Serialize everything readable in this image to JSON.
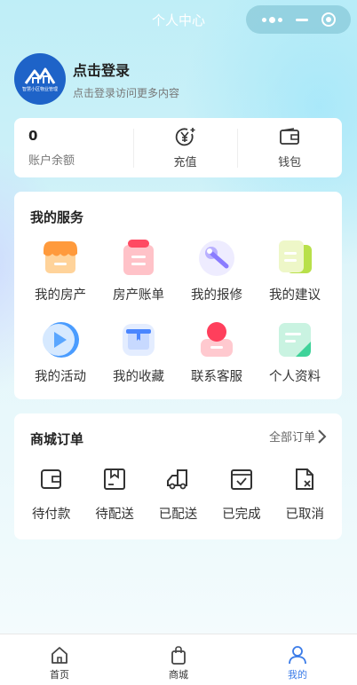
{
  "header": {
    "title": "个人中心"
  },
  "profile": {
    "login_title": "点击登录",
    "login_subtitle": "点击登录访问更多内容",
    "avatar_text": "智慧小区物业管理"
  },
  "balance": {
    "amount": "0",
    "amount_label": "账户余额",
    "recharge_label": "充值",
    "wallet_label": "钱包"
  },
  "services": {
    "title": "我的服务",
    "items": [
      {
        "label": "我的房产",
        "icon": "shop-icon",
        "color": "#ff9a3c"
      },
      {
        "label": "房产账单",
        "icon": "bill-icon",
        "color": "#ff5a6e"
      },
      {
        "label": "我的报修",
        "icon": "wrench-icon",
        "color": "#8a7cff"
      },
      {
        "label": "我的建议",
        "icon": "suggestion-icon",
        "color": "#b8e04a"
      },
      {
        "label": "我的活动",
        "icon": "play-icon",
        "color": "#4a9cff"
      },
      {
        "label": "我的收藏",
        "icon": "collect-icon",
        "color": "#4a86ff"
      },
      {
        "label": "联系客服",
        "icon": "service-icon",
        "color": "#ff4a66"
      },
      {
        "label": "个人资料",
        "icon": "profile-icon",
        "color": "#3fd39a"
      }
    ]
  },
  "orders": {
    "title": "商城订单",
    "all_label": "全部订单",
    "items": [
      {
        "label": "待付款",
        "icon": "wallet-icon"
      },
      {
        "label": "待配送",
        "icon": "package-icon"
      },
      {
        "label": "已配送",
        "icon": "truck-icon"
      },
      {
        "label": "已完成",
        "icon": "check-calendar-icon"
      },
      {
        "label": "已取消",
        "icon": "cancel-file-icon"
      }
    ]
  },
  "tabbar": {
    "items": [
      {
        "label": "首页",
        "icon": "home-icon",
        "active": false
      },
      {
        "label": "商城",
        "icon": "shopping-bag-icon",
        "active": false
      },
      {
        "label": "我的",
        "icon": "user-icon",
        "active": true
      }
    ],
    "active_color": "#3a7be8"
  }
}
